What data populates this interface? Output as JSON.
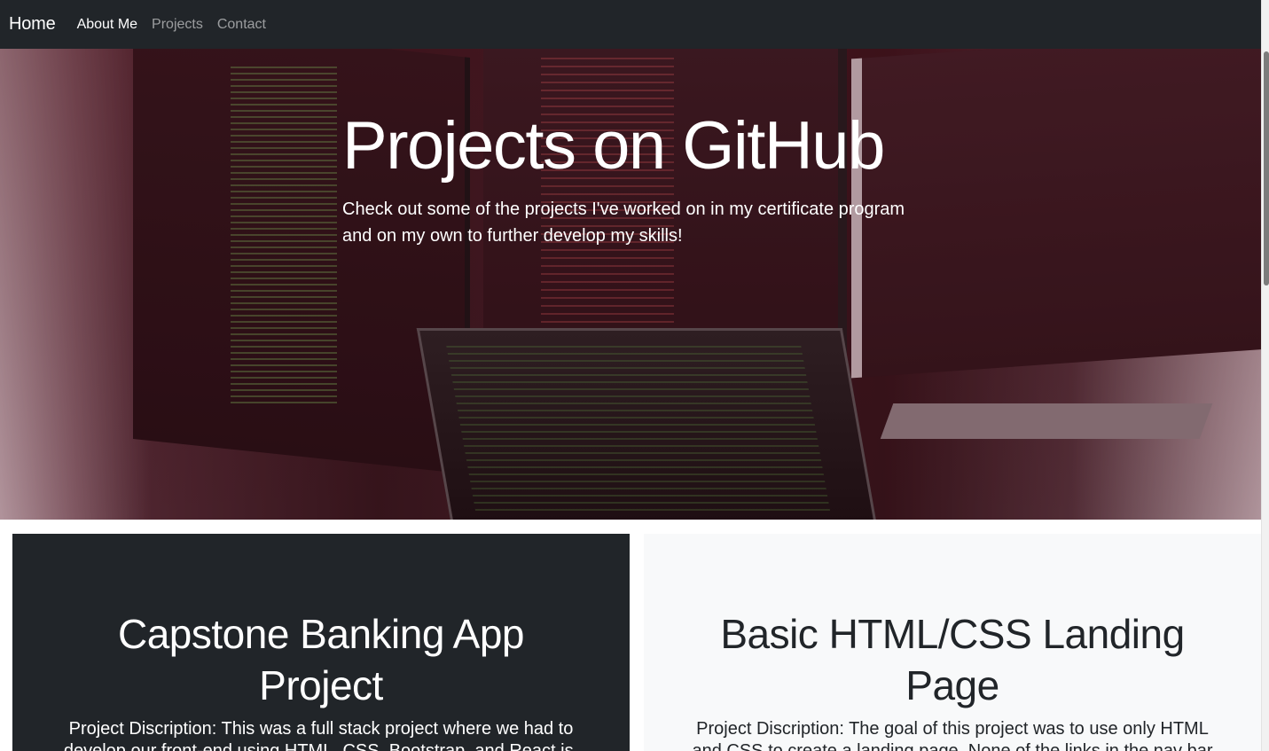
{
  "navbar": {
    "brand": "Home",
    "links": [
      {
        "label": "About Me",
        "state": "active"
      },
      {
        "label": "Projects",
        "state": "muted"
      },
      {
        "label": "Contact",
        "state": "muted"
      }
    ]
  },
  "hero": {
    "title": "Projects on GitHub",
    "subtitle": "Check out some of the projects I've worked on in my certificate program and on my own to further develop my skills!"
  },
  "projects": [
    {
      "title": "Capstone Banking App Project",
      "description": "Project Discription: This was a full stack project where we had to develop our front-end using HTML, CSS, Bootstrap, and React.js. Our"
    },
    {
      "title": "Basic HTML/CSS Landing Page",
      "description": "Project Discription: The goal of this project was to use only HTML and CSS to create a landing page. None of the links in the nav bar"
    }
  ],
  "colors": {
    "navbar_bg": "#212529",
    "card_dark_bg": "#212529",
    "card_light_bg": "#f8f9fa"
  }
}
